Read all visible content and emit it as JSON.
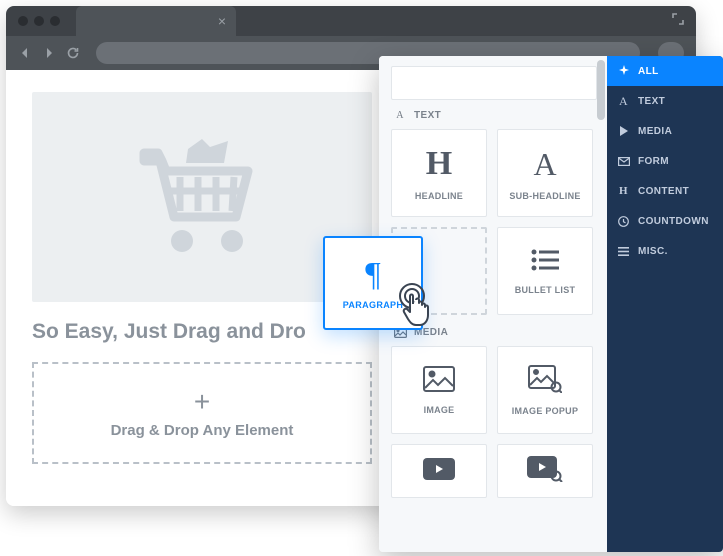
{
  "canvas": {
    "headline": "So Easy, Just Drag and Dro",
    "dropzone_label": "Drag & Drop Any Element"
  },
  "panel": {
    "sections": {
      "text": {
        "label": "TEXT",
        "tiles": {
          "headline": "HEADLINE",
          "subheadline": "SUB-HEADLINE",
          "bulletlist": "BULLET LIST"
        }
      },
      "media": {
        "label": "MEDIA",
        "tiles": {
          "image": "IMAGE",
          "imagepopup": "IMAGE POPUP"
        }
      }
    }
  },
  "dragging": {
    "label": "PARAGRAPH"
  },
  "sidebar": {
    "items": [
      {
        "label": "ALL"
      },
      {
        "label": "TEXT"
      },
      {
        "label": "MEDIA"
      },
      {
        "label": "FORM"
      },
      {
        "label": "CONTENT"
      },
      {
        "label": "COUNTDOWN"
      },
      {
        "label": "MISC."
      }
    ]
  }
}
